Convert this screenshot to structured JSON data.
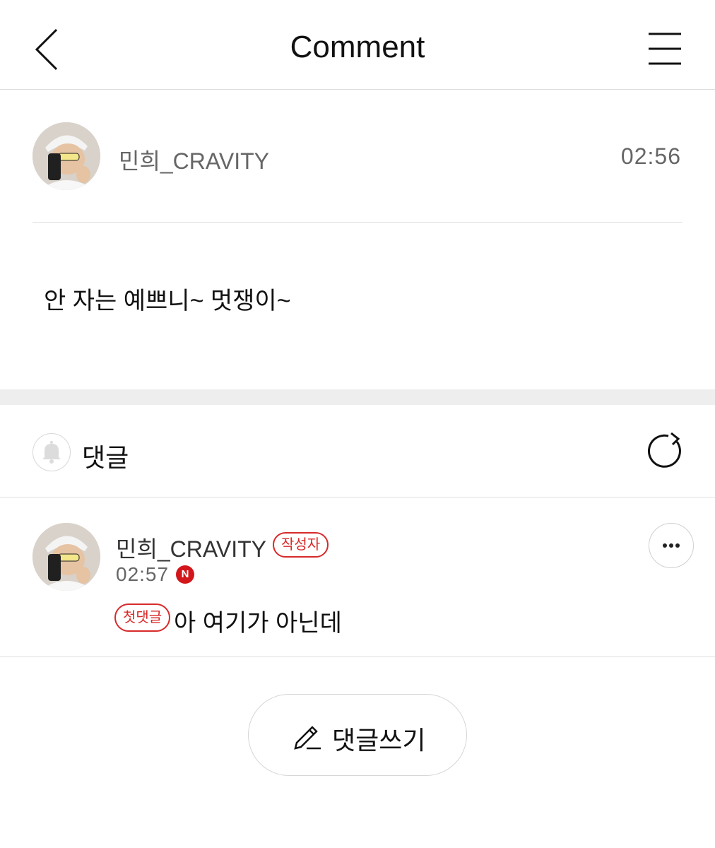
{
  "header": {
    "title": "Comment"
  },
  "post": {
    "author": "민희_CRAVITY",
    "time": "02:56",
    "body": "안 자는 예쁘니~ 멋쟁이~"
  },
  "comments_section": {
    "title": "댓글",
    "items": [
      {
        "author": "민희_CRAVITY",
        "author_badge": "작성자",
        "time": "02:57",
        "new_badge": "N",
        "first_badge": "첫댓글",
        "text": "아 여기가 아닌데"
      }
    ]
  },
  "write_button": {
    "label": "댓글쓰기"
  },
  "colors": {
    "accent_red": "#d82a2a",
    "divider": "#e2e2e2",
    "section_band": "#eeeeee",
    "muted_text": "#666666"
  },
  "icons": {
    "back": "chevron-left-icon",
    "menu": "hamburger-menu-icon",
    "bell": "bell-icon",
    "refresh": "refresh-icon",
    "more": "more-dots-icon",
    "write": "pencil-icon"
  }
}
